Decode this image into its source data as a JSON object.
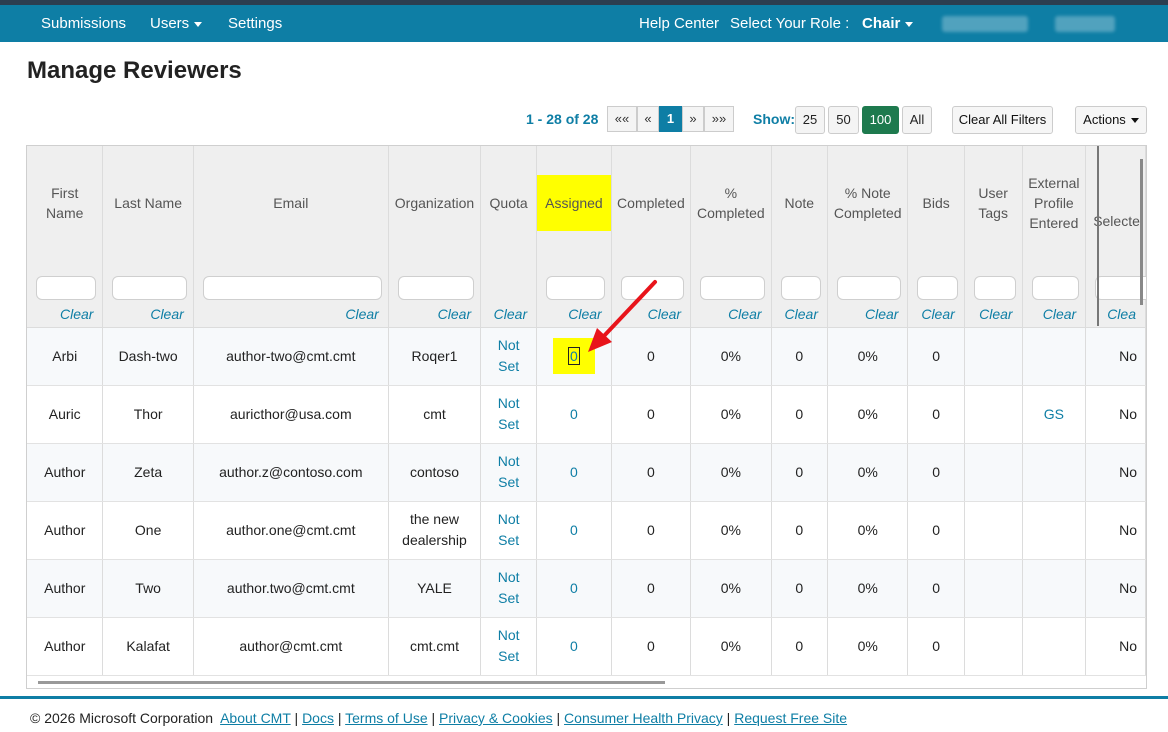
{
  "nav": {
    "submissions": "Submissions",
    "users": "Users",
    "settings": "Settings",
    "help_center": "Help Center",
    "select_role_label": "Select Your Role :",
    "role_value": "Chair"
  },
  "page": {
    "title": "Manage Reviewers"
  },
  "pager": {
    "range": "1 - 28 of",
    "total": "28",
    "first": "««",
    "prev": "«",
    "current": "1",
    "next": "»",
    "last": "»»"
  },
  "show": {
    "label": "Show:",
    "options": [
      "25",
      "50",
      "100",
      "All"
    ],
    "selected": "100"
  },
  "toolbar": {
    "clear_all_filters": "Clear All Filters",
    "actions": "Actions"
  },
  "columns": {
    "first_name": "First Name",
    "last_name": "Last Name",
    "email": "Email",
    "organization": "Organization",
    "quota": "Quota",
    "assigned": "Assigned",
    "completed": "Completed",
    "pct_completed": "% Completed",
    "note": "Note",
    "pct_note_completed": "% Note Completed",
    "bids": "Bids",
    "user_tags": "User Tags",
    "external_profile": "External Profile Entered",
    "selected": "Selecte"
  },
  "filter_clear_label": "Clear",
  "filter_clear_partial": "Clea",
  "rows": [
    {
      "first": "Arbi",
      "last": "Dash-two",
      "email": "author-two@cmt.cmt",
      "org": "Roqer1",
      "quota": "Not Set",
      "assigned": "0",
      "completed": "0",
      "pct": "0%",
      "note": "0",
      "pct_note": "0%",
      "bids": "0",
      "tags": "",
      "external": "",
      "selected": "No"
    },
    {
      "first": "Auric",
      "last": "Thor",
      "email": "auricthor@usa.com",
      "org": "cmt",
      "quota": "Not Set",
      "assigned": "0",
      "completed": "0",
      "pct": "0%",
      "note": "0",
      "pct_note": "0%",
      "bids": "0",
      "tags": "",
      "external": "GS",
      "selected": "No"
    },
    {
      "first": "Author",
      "last": "Zeta",
      "email": "author.z@contoso.com",
      "org": "contoso",
      "quota": "Not Set",
      "assigned": "0",
      "completed": "0",
      "pct": "0%",
      "note": "0",
      "pct_note": "0%",
      "bids": "0",
      "tags": "",
      "external": "",
      "selected": "No"
    },
    {
      "first": "Author",
      "last": "One",
      "email": "author.one@cmt.cmt",
      "org": "the new dealership",
      "quota": "Not Set",
      "assigned": "0",
      "completed": "0",
      "pct": "0%",
      "note": "0",
      "pct_note": "0%",
      "bids": "0",
      "tags": "",
      "external": "",
      "selected": "No"
    },
    {
      "first": "Author",
      "last": "Two",
      "email": "author.two@cmt.cmt",
      "org": "YALE",
      "quota": "Not Set",
      "assigned": "0",
      "completed": "0",
      "pct": "0%",
      "note": "0",
      "pct_note": "0%",
      "bids": "0",
      "tags": "",
      "external": "",
      "selected": "No"
    },
    {
      "first": "Author",
      "last": "Kalafat",
      "email": "author@cmt.cmt",
      "org": "cmt.cmt",
      "quota": "Not Set",
      "assigned": "0",
      "completed": "0",
      "pct": "0%",
      "note": "0",
      "pct_note": "0%",
      "bids": "0",
      "tags": "",
      "external": "",
      "selected": "No"
    }
  ],
  "footer": {
    "copyright": "© 2026 Microsoft Corporation",
    "links": [
      "About CMT",
      "Docs",
      "Terms of Use",
      "Privacy & Cookies",
      "Consumer Health Privacy",
      "Request Free Site"
    ]
  },
  "colors": {
    "brand": "#0e7ea5",
    "highlight": "#ffff00",
    "annotation_arrow": "#e8141b",
    "active_show": "#1e7a4e"
  }
}
